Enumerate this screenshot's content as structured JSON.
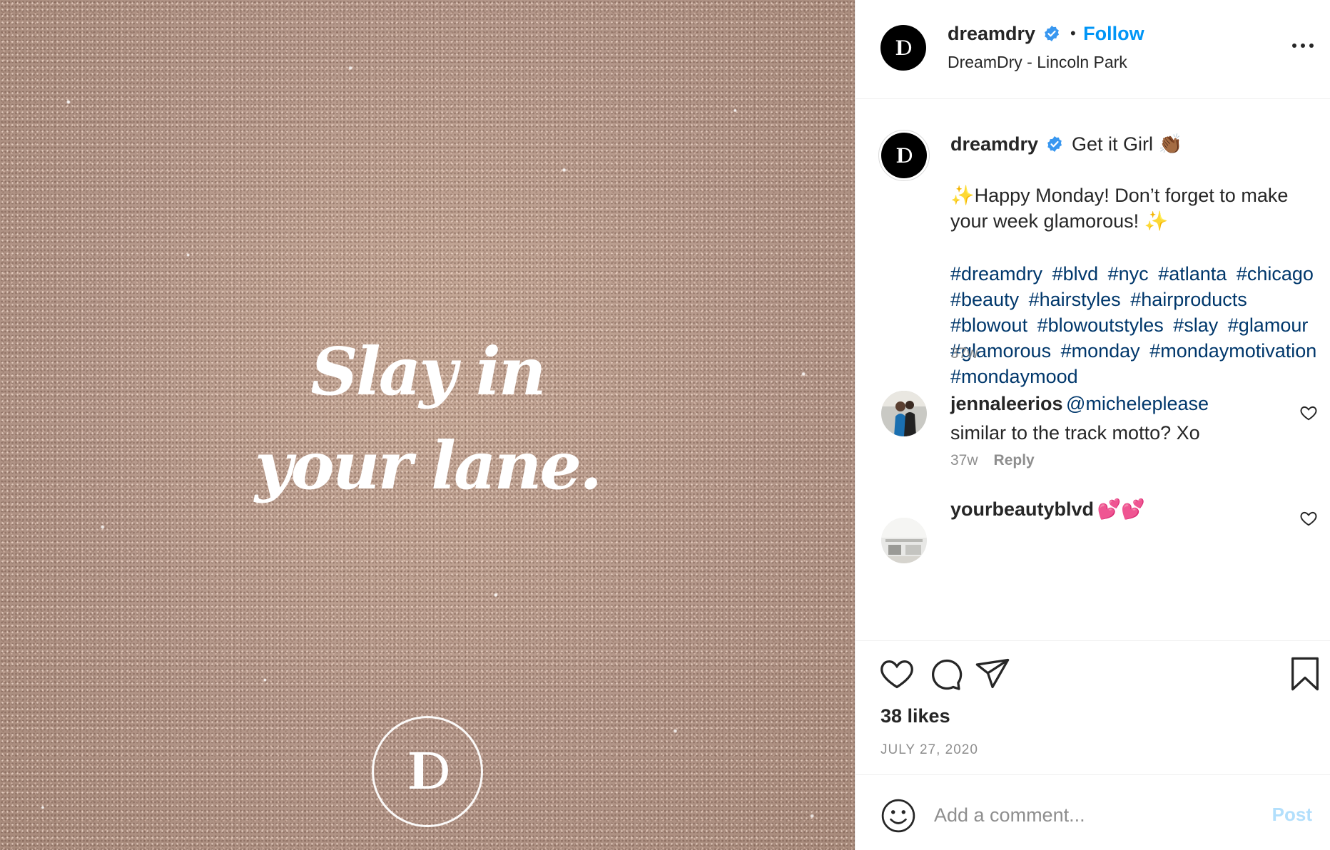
{
  "image": {
    "slogan_line1": "Slay in",
    "slogan_line2": "your lane.",
    "logo_mark": "ID"
  },
  "header": {
    "username": "dreamdry",
    "separator": "•",
    "follow_label": "Follow",
    "location": "DreamDry - Lincoln Park",
    "avatar_mark": "ID"
  },
  "caption": {
    "username": "dreamdry",
    "headline": "Get it Girl 👏🏾",
    "spark_left": "✨",
    "body": "Happy Monday! Don’t forget to make your week glamorous! ",
    "spark_right": "✨",
    "hashtags": [
      "#dreamdry",
      "#blvd",
      "#nyc",
      "#atlanta",
      "#chicago",
      "#beauty",
      "#hairstyles",
      "#hairproducts",
      "#blowout",
      "#blowoutstyles",
      "#slay",
      "#glamour",
      "#glamorous",
      "#monday",
      "#mondaymotivation",
      "#mondaymood"
    ],
    "age": "37w"
  },
  "comments": [
    {
      "username": "jennaleerios",
      "mention": "@micheleplease",
      "text": "similar to the track motto? Xo",
      "age": "37w",
      "reply_label": "Reply"
    },
    {
      "username": "yourbeautyblvd",
      "text": "💕💕"
    }
  ],
  "actions": {
    "likes": "38 likes",
    "date": "JULY 27, 2020"
  },
  "add_comment": {
    "placeholder": "Add a comment...",
    "post_label": "Post"
  },
  "colors": {
    "link": "#0095f6",
    "hashtag": "#00376b",
    "muted": "#8e8e8e",
    "verified": "#3897f0",
    "post_disabled": "#b2dffc"
  },
  "icons": [
    "verified-badge-icon",
    "more-options-icon",
    "heart-icon",
    "comment-icon",
    "share-icon",
    "bookmark-icon",
    "emoji-icon"
  ]
}
